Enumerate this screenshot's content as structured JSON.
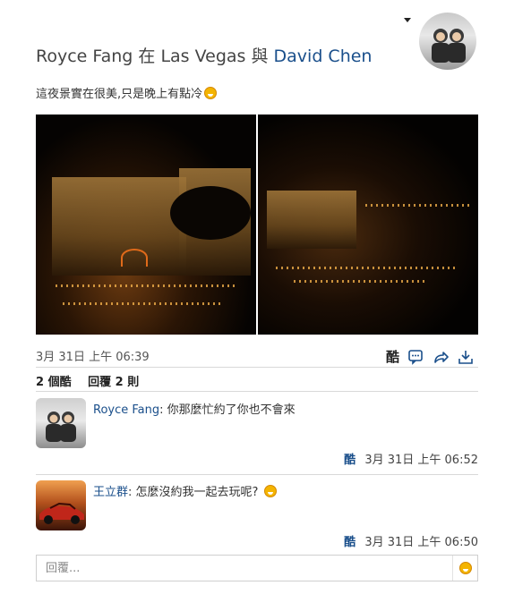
{
  "post": {
    "author": "Royce Fang",
    "location_connector": "在",
    "location": "Las Vegas",
    "with_connector": "與",
    "tagged": "David Chen",
    "status_text": "這夜景實在很美,只是晚上有點冷",
    "status_emoji": "smile-emoji-icon",
    "timestamp": "3月 31日 上午 06:39",
    "like_label": "酷",
    "icons": [
      "comment-icon",
      "share-icon",
      "download-icon"
    ]
  },
  "stats": {
    "likes": "2 個酷",
    "replies": "回覆 2 則"
  },
  "comments": [
    {
      "name": "Royce Fang",
      "separator": ":",
      "text": "你那麼忙約了你也不會來",
      "like_label": "酷",
      "time": "3月 31日 上午 06:52"
    },
    {
      "name": "王立群",
      "separator": ":",
      "text": "怎麼沒約我一起去玩呢?",
      "like_label": "酷",
      "time": "3月 31日 上午 06:50"
    }
  ],
  "reply": {
    "placeholder": "回覆..."
  },
  "colors": {
    "link": "#1a4f8b",
    "emoji": "#f4b400"
  }
}
